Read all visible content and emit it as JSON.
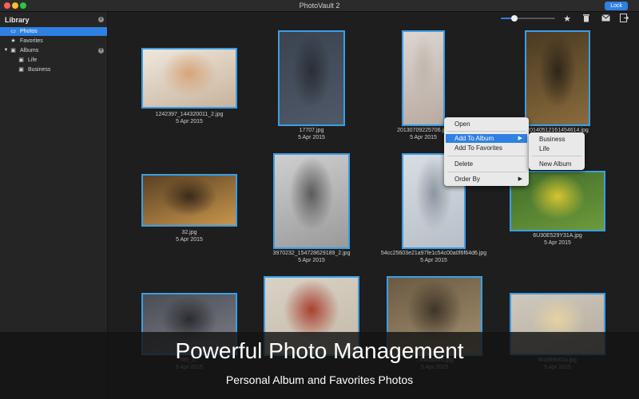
{
  "window": {
    "title": "PhotoVault 2",
    "lock_label": "Lock"
  },
  "sidebar": {
    "header": "Library",
    "items": [
      {
        "label": "Photos",
        "icon": "photo-icon",
        "selected": true
      },
      {
        "label": "Favorites",
        "icon": "star-icon"
      },
      {
        "label": "Albums",
        "icon": "album-icon",
        "expanded": true
      },
      {
        "label": "Life",
        "icon": "album-icon"
      },
      {
        "label": "Business",
        "icon": "album-icon"
      }
    ]
  },
  "toolbar": {
    "zoom_level": 0.25,
    "icons": [
      "star-icon",
      "trash-icon",
      "mail-icon",
      "export-icon"
    ]
  },
  "photos": [
    {
      "filename": "1242397_144320011_2.jpg",
      "date": "5 Apr 2015",
      "colors": [
        "#efe7dc",
        "#c8b39c",
        "#d6a579"
      ]
    },
    {
      "filename": "17707.jpg",
      "date": "5 Apr 2015",
      "colors": [
        "#3b4350",
        "#4f5968",
        "#2a2f36"
      ]
    },
    {
      "filename": "20130709225706.jpg",
      "date": "5 Apr 2015",
      "colors": [
        "#dcd6d1",
        "#b8aaa0",
        "#c1b6ae"
      ]
    },
    {
      "filename": "20140512161454614.jpg",
      "date": "5 Apr 2015",
      "colors": [
        "#4a3a22",
        "#8a6b3d",
        "#2e2618"
      ]
    },
    {
      "filename": "32.jpg",
      "date": "5 Apr 2015",
      "colors": [
        "#5a4024",
        "#c8964c",
        "#3a2a1a"
      ]
    },
    {
      "filename": "3970232_154728629189_2.jpg",
      "date": "5 Apr 2015",
      "colors": [
        "#cfcfcf",
        "#9a9a9a",
        "#5b5b5b"
      ]
    },
    {
      "filename": "54cc25603e21a97fe1c54c00a0f6f64d6.jpg",
      "date": "5 Apr 2015",
      "colors": [
        "#d8dde2",
        "#b7bfc7",
        "#8d97a2"
      ]
    },
    {
      "filename": "6U30E529Y31A.jpg",
      "date": "5 Apr 2015",
      "colors": [
        "#3f6b2a",
        "#6e9a3c",
        "#d7c430"
      ]
    },
    {
      "filename": "785_3...",
      "date": "5 Apr 2015",
      "colors": [
        "#4a4d55",
        "#7c7f88",
        "#2b2c31"
      ]
    },
    {
      "filename": "",
      "date": "",
      "colors": [
        "#d8d2c6",
        "#c5b9a8",
        "#a9402f"
      ]
    },
    {
      "filename": "...kskd6xxls.jpg",
      "date": "5 Apr 2015",
      "colors": [
        "#6a5a43",
        "#a4916f",
        "#3f3528"
      ]
    },
    {
      "filename": "f41069c61a.jpg",
      "date": "5 Apr 2015",
      "colors": [
        "#cfc9be",
        "#b3ab9c",
        "#e6d3a3"
      ]
    }
  ],
  "context_menu": {
    "items": [
      "Open",
      "Add To Album",
      "Add To Favorites",
      "Delete",
      "Order By"
    ],
    "submenu": [
      "Business",
      "Life",
      "New Album"
    ]
  },
  "banner": {
    "title": "Powerful Photo Management",
    "subtitle": "Personal Album and Favorites Photos"
  },
  "colors": {
    "accent": "#2f80e3",
    "photo_border": "#3a9ee8",
    "background": "#1e1e1e",
    "sidebar": "#252525"
  }
}
